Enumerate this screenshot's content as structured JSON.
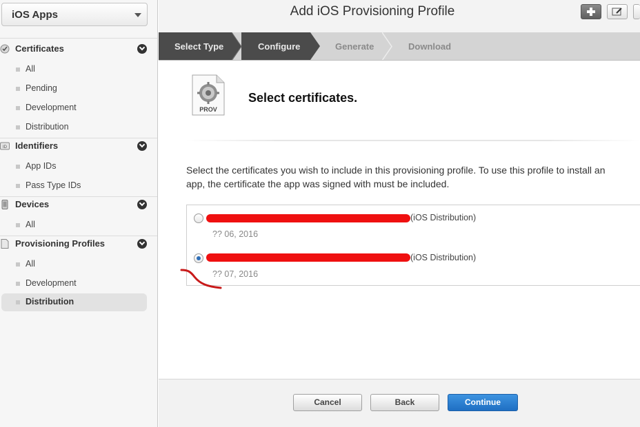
{
  "sidebar": {
    "app_selector": "iOS Apps",
    "sections": [
      {
        "label": "Certificates",
        "icon": "certificate-icon",
        "items": [
          "All",
          "Pending",
          "Development",
          "Distribution"
        ]
      },
      {
        "label": "Identifiers",
        "icon": "id-icon",
        "items": [
          "App IDs",
          "Pass Type IDs"
        ]
      },
      {
        "label": "Devices",
        "icon": "device-icon",
        "items": [
          "All"
        ]
      },
      {
        "label": "Provisioning Profiles",
        "icon": "profile-icon",
        "items": [
          "All",
          "Development",
          "Distribution"
        ]
      }
    ],
    "active_item": "Provisioning Profiles / Distribution",
    "certificates_label": "Certificates",
    "identifiers_label": "Identifiers",
    "devices_label": "Devices",
    "profiles_label": "Provisioning Profiles",
    "cert_all": "All",
    "cert_pending": "Pending",
    "cert_development": "Development",
    "cert_distribution": "Distribution",
    "id_app_ids": "App IDs",
    "id_pass_type_ids": "Pass Type IDs",
    "devices_all": "All",
    "profiles_all": "All",
    "profiles_development": "Development",
    "profiles_distribution": "Distribution"
  },
  "header": {
    "title": "Add iOS Provisioning Profile"
  },
  "steps": [
    {
      "label": "Select Type",
      "state": "done"
    },
    {
      "label": "Configure",
      "state": "current"
    },
    {
      "label": "Generate",
      "state": "pending"
    },
    {
      "label": "Download",
      "state": "pending"
    }
  ],
  "steps_labels": {
    "select_type": "Select Type",
    "configure": "Configure",
    "generate": "Generate",
    "download": "Download"
  },
  "main": {
    "icon_label": "PROV",
    "section_title": "Select certificates.",
    "description": "Select the certificates you wish to include in this provisioning profile. To use this profile to install an app, the certificate the app was signed with must be included.",
    "certificates": [
      {
        "type": "(iOS Distribution)",
        "date": "?? 06, 2016",
        "selected": false
      },
      {
        "type": "(iOS Distribution)",
        "date": "?? 07, 2016",
        "selected": true
      }
    ],
    "cert1_type": "(iOS Distribution)",
    "cert1_date": "?? 06, 2016",
    "cert2_type": "(iOS Distribution)",
    "cert2_date": "?? 07, 2016"
  },
  "footer": {
    "cancel_label": "Cancel",
    "back_label": "Back",
    "continue_label": "Continue"
  },
  "colors": {
    "accent": "#1f6fc3",
    "step_active_bg": "#4b4b4b",
    "redaction": "#ef1010"
  }
}
